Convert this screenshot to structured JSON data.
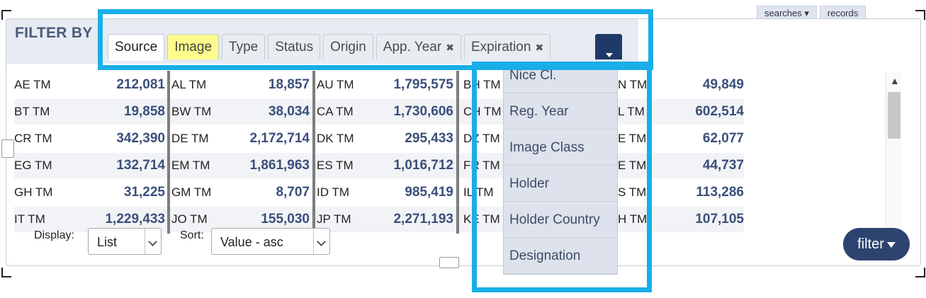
{
  "header": {
    "top_pills": [
      "searches ▾",
      "records"
    ],
    "title": "FILTER BY"
  },
  "tabs": [
    {
      "label": "Source",
      "state": "active"
    },
    {
      "label": "Image",
      "state": "highlight"
    },
    {
      "label": "Type",
      "state": "normal"
    },
    {
      "label": "Status",
      "state": "normal"
    },
    {
      "label": "Origin",
      "state": "normal"
    },
    {
      "label": "App. Year",
      "state": "normal",
      "closable": true
    },
    {
      "label": "Expiration",
      "state": "normal",
      "closable": true
    }
  ],
  "close_glyph": "✖",
  "more_tabs_icon": "chevron-down-icon",
  "rows": [
    {
      "c1": [
        "AE TM",
        "212,081"
      ],
      "c2": [
        "AL TM",
        "18,857"
      ],
      "c3": [
        "AU TM",
        "1,795,575"
      ],
      "c4": "BH TM",
      "c5": [
        "N TM",
        "49,849"
      ]
    },
    {
      "c1": [
        "BT TM",
        "19,858"
      ],
      "c2": [
        "BW TM",
        "38,034"
      ],
      "c3": [
        "CA TM",
        "1,730,606"
      ],
      "c4": "CH TM",
      "c5": [
        "L TM",
        "602,514"
      ]
    },
    {
      "c1": [
        "CR TM",
        "342,390"
      ],
      "c2": [
        "DE TM",
        "2,172,714"
      ],
      "c3": [
        "DK TM",
        "295,433"
      ],
      "c4": "DZ TM",
      "c5": [
        "E TM",
        "62,077"
      ]
    },
    {
      "c1": [
        "EG TM",
        "132,714"
      ],
      "c2": [
        "EM TM",
        "1,861,963"
      ],
      "c3": [
        "ES TM",
        "1,016,712"
      ],
      "c4": "FR TM",
      "c5": [
        "E TM",
        "44,737"
      ]
    },
    {
      "c1": [
        "GH TM",
        "31,225"
      ],
      "c2": [
        "GM TM",
        "8,707"
      ],
      "c3": [
        "ID TM",
        "985,419"
      ],
      "c4": "IL TM",
      "c5": [
        "S TM",
        "113,286"
      ]
    },
    {
      "c1": [
        "IT TM",
        "1,229,433"
      ],
      "c2": [
        "JO TM",
        "155,030"
      ],
      "c3": [
        "JP TM",
        "2,271,193"
      ],
      "c4": "KE TM",
      "c5": [
        "H TM",
        "107,105"
      ]
    }
  ],
  "dropdown": [
    "Nice Cl.",
    "Reg. Year",
    "Image Class",
    "Holder",
    "Holder Country",
    "Designation"
  ],
  "display": {
    "label": "Display:",
    "value": "List"
  },
  "sort": {
    "label": "Sort:",
    "value": "Value - asc"
  },
  "filter_button": {
    "label": "filter"
  },
  "colors": {
    "accent": "#19aee8",
    "navy": "#2e4470",
    "value": "#3a4f7a",
    "highlight_tab": "#fdfb8c"
  }
}
